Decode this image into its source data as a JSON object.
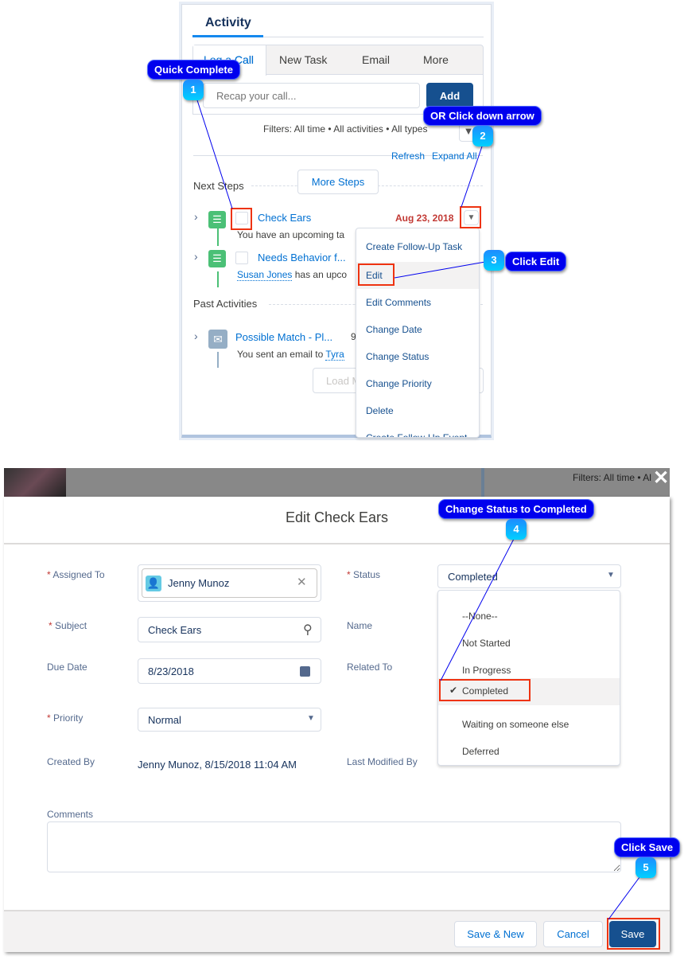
{
  "activity": {
    "title": "Activity",
    "tabs": [
      "Log a Call",
      "New Task",
      "Email",
      "More"
    ],
    "visible_tab_fragment": "Call",
    "recap_placeholder": "Recap your call...",
    "add_label": "Add",
    "filters": "Filters: All time • All activities • All types",
    "refresh": "Refresh",
    "expand_all": "Expand All",
    "next_steps": "Next Steps",
    "more_steps": "More Steps",
    "tasks": [
      {
        "title": "Check Ears",
        "date": "Aug 23, 2018",
        "desc": "You have an upcoming ta"
      },
      {
        "title": "Needs Behavior f...",
        "person": "Susan Jones",
        "desc": " has an upco"
      }
    ],
    "past_activities": "Past Activities",
    "past": {
      "title": "Possible Match - Pl...",
      "extra": "9",
      "desc": "You sent an email to ",
      "person": "Tyra"
    },
    "load_more": "Load M",
    "menu": [
      "Create Follow-Up Task",
      "Edit",
      "Edit Comments",
      "Change Date",
      "Change Status",
      "Change Priority",
      "Delete",
      "Create Follow-Up Event"
    ]
  },
  "background": {
    "filters": "Filters: All time • Al"
  },
  "modal": {
    "title": "Edit Check Ears",
    "labels": {
      "assigned_to": "Assigned To",
      "subject": "Subject",
      "due_date": "Due Date",
      "priority": "Priority",
      "created_by": "Created By",
      "status": "Status",
      "name": "Name",
      "related_to": "Related To",
      "last_modified_by": "Last Modified By",
      "comments": "Comments"
    },
    "assigned_to": "Jenny Munoz",
    "subject": "Check Ears",
    "due_date": "8/23/2018",
    "priority": "Normal",
    "created_by": "Jenny Munoz, 8/15/2018 11:04 AM",
    "status": "Completed",
    "status_options": [
      "--None--",
      "Not Started",
      "In Progress",
      "Completed",
      "Waiting on someone else",
      "Deferred"
    ],
    "buttons": {
      "save_new": "Save & New",
      "cancel": "Cancel",
      "save": "Save"
    }
  },
  "callouts": [
    {
      "n": "1",
      "text": "Quick Complete"
    },
    {
      "n": "2",
      "text": "OR Click down arrow"
    },
    {
      "n": "3",
      "text": "Click Edit"
    },
    {
      "n": "4",
      "text": "Change Status to Completed"
    },
    {
      "n": "5",
      "text": "Click Save"
    }
  ],
  "colors": {
    "brand": "#16508f",
    "link": "#0070d2",
    "callout": "#0000ee",
    "highlight": "#ee3311",
    "overdue": "#c23934"
  }
}
